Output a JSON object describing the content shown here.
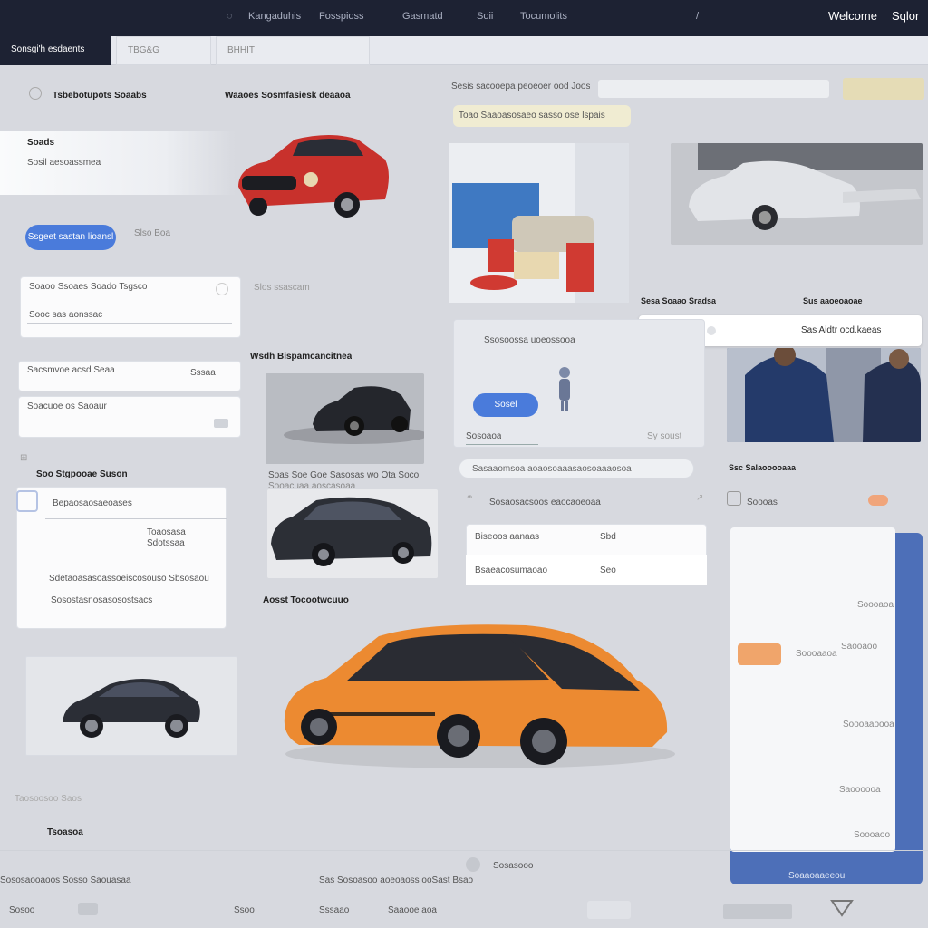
{
  "topbar": {
    "nav": [
      "Kangaduhis",
      "Fosspioss",
      "Gasmatd",
      "Soii",
      "Tocumolits"
    ],
    "welcome": "Welcome",
    "signin": "Sqlor"
  },
  "tabs": [
    "Sonsgi'h esdaents",
    "TBG&G",
    "BHHIT"
  ],
  "left": {
    "header": "Tsbebotupots Soaabs",
    "promo_title": "Soads",
    "promo_sub": "Sosil aesoassmea",
    "primary_button": "Ssgeet sastan lioansl",
    "secondary_button": "Slso Boa",
    "form_rows": [
      "Soaoo Ssoaes Soado Tsgsco",
      "Sooc sas aonssac",
      "Sacsmvoe acsd Seaa",
      "Soacuoe os Saoaur"
    ],
    "counter": "Sssaa",
    "list_title": "Soo Stgpooae Suson",
    "list_head": "Bepaosaosaeoases",
    "list_a": "Toaosasa",
    "list_b": "Sdotssaa",
    "list_c": "Sdetaoasasoassoeiscosouso Sbsosaou",
    "list_d": "Sosostasnosasosostsacs",
    "footer_a": "Taosoosoo Saos",
    "footer_b": "Tsoasoa"
  },
  "middle": {
    "hero_caption": "Waaoes Sosmfasiesk deaaoa",
    "hero_sub": "Slos ssascam",
    "section_title": "Wsdh Bispamcancitnea",
    "caption_a": "Soas Soe Goe Sasosas wo Ota Soco",
    "caption_b": "Sooacuaa aoscasoaa",
    "section_b": "Aosst Tocootwcuuo"
  },
  "right": {
    "search_label": "Sesis sacooepa peoeoer ood Joos",
    "notice": "Toao Saaoasosaeo sasso ose lspais",
    "label_a": "Sesa Soaao Sradsa",
    "label_b": "Sus aaoeoaoae",
    "popup_text": "Sas Aidtr ocd.kaeas",
    "slot_text": "Ssosoossa uoeossooa",
    "confirm_button": "Sosel",
    "status_text": "Sosoaoa",
    "status_right": "Sy soust",
    "pill_text": "Sasaaomsoa aoaosoaaasaosoaaaosoa",
    "notify": "Sosaosacsoos eaocaoeoaa",
    "table_rows": [
      {
        "label": "Biseoos aanaas",
        "value": "Sbd"
      },
      {
        "label": "Bsaeacosumaoao",
        "value": "Seo"
      }
    ],
    "profile_title": "Ssc Salaooooaaa",
    "side_label": "Soooas",
    "side_items": [
      "Soooaoa",
      "Soooaaoa",
      "Saooaoo",
      "Soooaaoooa",
      "Saoooooa",
      "Soooaoo"
    ],
    "side_footer": "Soaaoaaeeou"
  },
  "bottom": {
    "items": [
      "Sososaooaoos Sosso Saouasaa",
      "Sas Sosoasoo aoeoaoss ooSast Bsao",
      "Sosasooo",
      "Sosoo",
      "Ssoo",
      "Sssaao",
      "Saaooe aoa"
    ]
  },
  "colors": {
    "topbar": "#1d2233",
    "accent": "#4a7bdb",
    "orange": "#f0a56b",
    "sidebar_blue": "#4d6fb8"
  }
}
